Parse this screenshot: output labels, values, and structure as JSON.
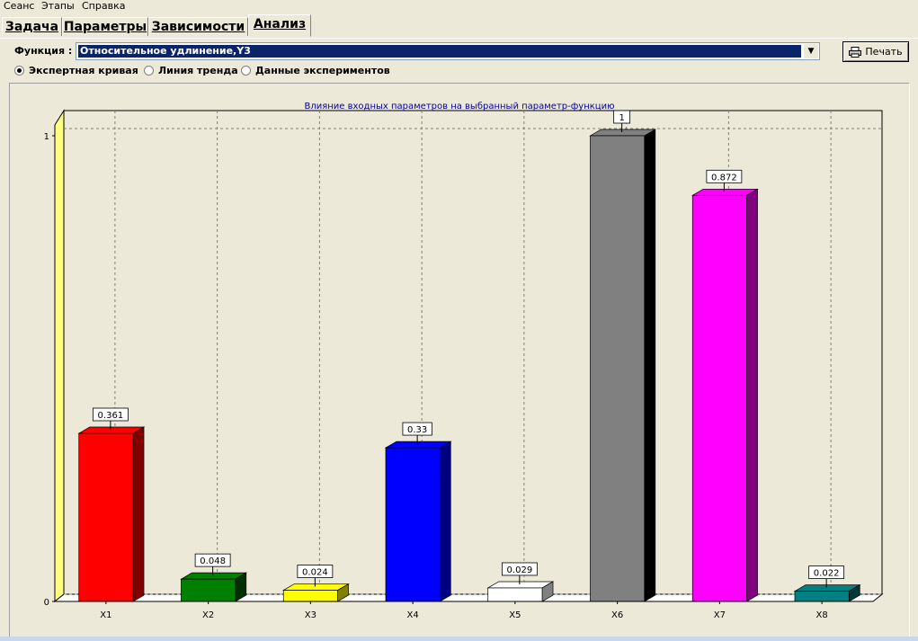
{
  "menu": [
    "Сеанс",
    "Этапы",
    "Справка"
  ],
  "tabs": [
    "Задача",
    "Параметры",
    "Зависимости",
    "Анализ"
  ],
  "function_label": "Функция :",
  "function_value": "Относительное удлинение,Y3",
  "print_label": "Печать",
  "radios": [
    {
      "label": "Экспертная кривая",
      "checked": true
    },
    {
      "label": "Линия тренда",
      "checked": false
    },
    {
      "label": "Данные экспериментов",
      "checked": false
    }
  ],
  "chart_data": {
    "type": "bar",
    "title": "Влияние входных параметров на  выбранный параметр-функцию",
    "categories": [
      "X1",
      "X2",
      "X3",
      "X4",
      "X5",
      "X6",
      "X7",
      "X8"
    ],
    "values": [
      0.361,
      0.048,
      0.024,
      0.33,
      0.029,
      1,
      0.872,
      0.022
    ],
    "value_labels": [
      "0.361",
      "0.048",
      "0.024",
      "0.33",
      "0.029",
      "1",
      "0.872",
      "0.022"
    ],
    "colors": [
      "#ff0000",
      "#008000",
      "#ffff00",
      "#0000ff",
      "#ffffff",
      "#808080",
      "#ff00ff",
      "#008080"
    ],
    "side_colors": [
      "#800000",
      "#003000",
      "#808000",
      "#000080",
      "#808080",
      "#000000",
      "#800080",
      "#003838"
    ],
    "ylim": [
      0,
      1
    ],
    "yticks": [
      "0",
      "1"
    ],
    "grid": true,
    "title_color": "#0000a0",
    "wall_color": "#ffff80"
  }
}
